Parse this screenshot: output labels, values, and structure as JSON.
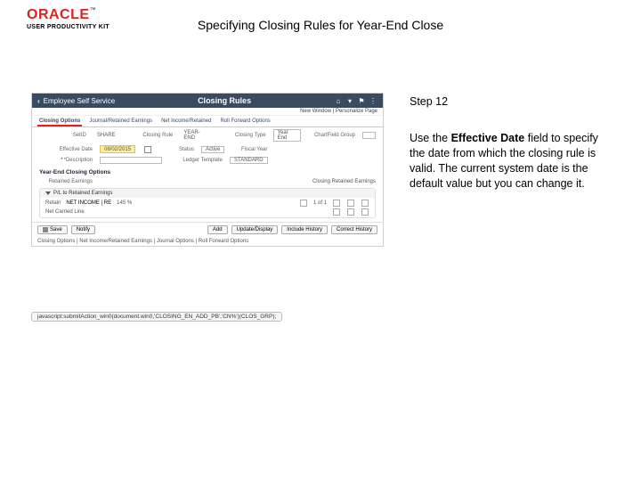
{
  "logo": {
    "brand": "ORACLE",
    "tm": "™",
    "sub": "USER PRODUCTIVITY KIT"
  },
  "doc_title": "Specifying Closing Rules for Year-End Close",
  "step_label": "Step 12",
  "instruction_pre": "Use the ",
  "instruction_bold": "Effective Date",
  "instruction_post": " field to specify the date from which the closing rule is valid. The current system date is the default value but you can change it.",
  "shot": {
    "back_label": "Employee Self Service",
    "title": "Closing Rules",
    "crumb": "New Window | Personalize Page",
    "tabs": [
      "Closing Options",
      "Journal/Retained Earnings",
      "Net Income/Retained",
      "Roll Forward Options"
    ],
    "row1": {
      "lab1": "SetID",
      "val1": "SHARE",
      "lab2": "Closing Rule",
      "val2": "YEAR-END",
      "lab3": "Closing Type",
      "val3": "Year End",
      "lab4": "ChartField Group"
    },
    "row2": {
      "lab": "Effective Date",
      "val": "08/02/2015",
      "status_lab": "Status",
      "status_val": "Active",
      "fy_lab": "Fiscal Year",
      "fy_val": ""
    },
    "row3": {
      "lab": "*Description",
      "val": "",
      "lab2": "Ledger Template",
      "val2": "STANDARD"
    },
    "sec1": "Year-End Closing Options",
    "sec1_sub": "Retained Earnings",
    "sec2": "Closing Retained Earnings",
    "subbox_title": "P/L to Retained Earnings",
    "subbox_row1": {
      "lab1": "Retain",
      "val": "NET INCOME | RE",
      "mid": "145 %",
      "right": "1 of 1"
    },
    "subbox_row2": "Net Carried Line",
    "footer": {
      "save": "Save",
      "notify": "Notify",
      "add": "Add",
      "update": "Update/Display",
      "include": "Include History",
      "correct": "Correct History"
    },
    "crumb2": "Closing Options | Net Income/Retained Earnings | Journal Options | Roll Forward Options"
  },
  "url": "javascript:submitAction_win0(document.win0,'CLOSING_EN_ADD_PB','CN%')(CLOS_GRP);"
}
